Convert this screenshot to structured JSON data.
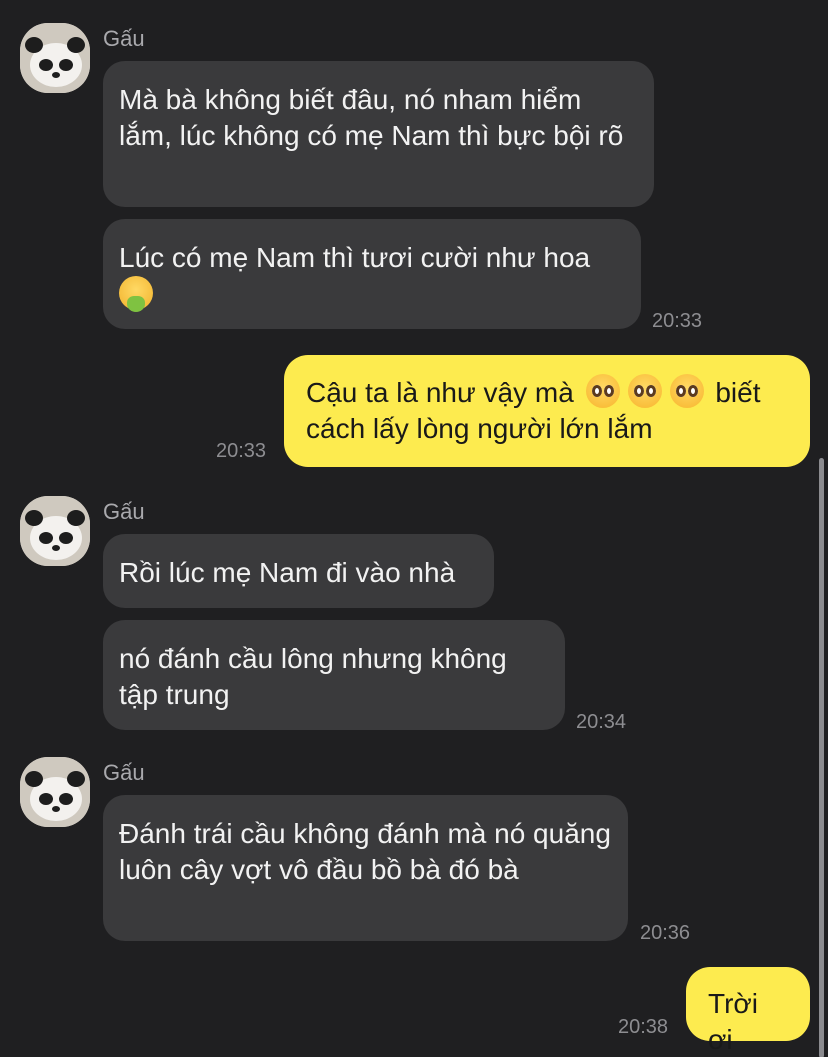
{
  "sender_name": "Gấu",
  "messages": [
    {
      "text": "Mà bà không biết đâu, nó nham hiểm lắm, lúc không có mẹ Nam thì bực bội rõ"
    },
    {
      "text_before_emoji": "Lúc có mẹ Nam thì tươi cười như hoa",
      "emoji": "face-vomiting-emoji",
      "time": "20:33"
    },
    {
      "text_before_emoji": "Cậu ta là như vậy mà",
      "text_after_emoji": "biết cách lấy lòng người lớn lắm",
      "emoji": "pleading-face-emoji",
      "time": "20:33"
    },
    {
      "text": "Rồi lúc mẹ Nam đi vào nhà"
    },
    {
      "text": "nó đánh cầu lông nhưng không tập trung",
      "time": "20:34"
    },
    {
      "text": "Đánh trái cầu không đánh mà nó quăng luôn cây vợt vô đầu bồ bà đó bà",
      "time": "20:36"
    },
    {
      "text": "Trời ơi",
      "time": "20:38"
    }
  ],
  "colors": {
    "background": "#1f1f21",
    "incoming_bubble": "#3a3a3c",
    "outgoing_bubble": "#fdeb4f"
  }
}
